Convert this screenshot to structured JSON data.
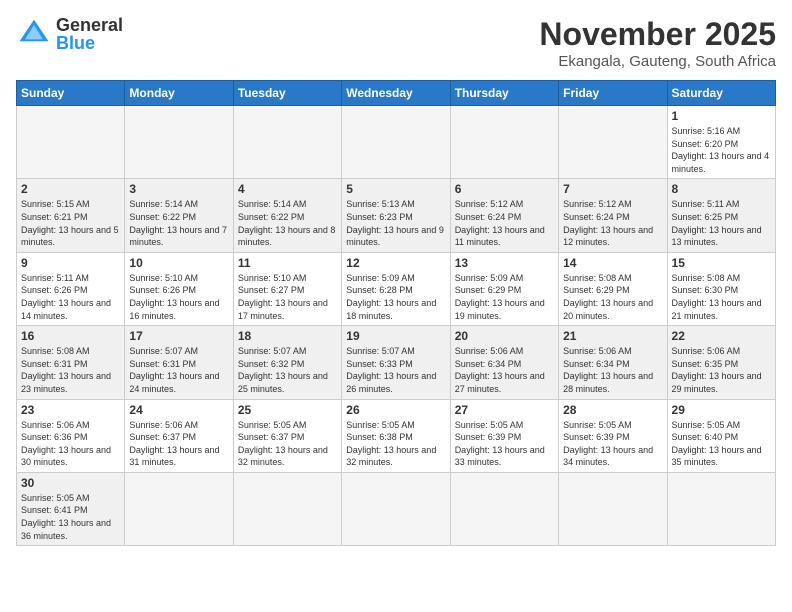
{
  "header": {
    "logo_general": "General",
    "logo_blue": "Blue",
    "month": "November 2025",
    "location": "Ekangala, Gauteng, South Africa"
  },
  "days_of_week": [
    "Sunday",
    "Monday",
    "Tuesday",
    "Wednesday",
    "Thursday",
    "Friday",
    "Saturday"
  ],
  "weeks": [
    [
      {
        "day": "",
        "info": ""
      },
      {
        "day": "",
        "info": ""
      },
      {
        "day": "",
        "info": ""
      },
      {
        "day": "",
        "info": ""
      },
      {
        "day": "",
        "info": ""
      },
      {
        "day": "",
        "info": ""
      },
      {
        "day": "1",
        "info": "Sunrise: 5:16 AM\nSunset: 6:20 PM\nDaylight: 13 hours and 4 minutes."
      }
    ],
    [
      {
        "day": "2",
        "info": "Sunrise: 5:15 AM\nSunset: 6:21 PM\nDaylight: 13 hours and 5 minutes."
      },
      {
        "day": "3",
        "info": "Sunrise: 5:14 AM\nSunset: 6:22 PM\nDaylight: 13 hours and 7 minutes."
      },
      {
        "day": "4",
        "info": "Sunrise: 5:14 AM\nSunset: 6:22 PM\nDaylight: 13 hours and 8 minutes."
      },
      {
        "day": "5",
        "info": "Sunrise: 5:13 AM\nSunset: 6:23 PM\nDaylight: 13 hours and 9 minutes."
      },
      {
        "day": "6",
        "info": "Sunrise: 5:12 AM\nSunset: 6:24 PM\nDaylight: 13 hours and 11 minutes."
      },
      {
        "day": "7",
        "info": "Sunrise: 5:12 AM\nSunset: 6:24 PM\nDaylight: 13 hours and 12 minutes."
      },
      {
        "day": "8",
        "info": "Sunrise: 5:11 AM\nSunset: 6:25 PM\nDaylight: 13 hours and 13 minutes."
      }
    ],
    [
      {
        "day": "9",
        "info": "Sunrise: 5:11 AM\nSunset: 6:26 PM\nDaylight: 13 hours and 14 minutes."
      },
      {
        "day": "10",
        "info": "Sunrise: 5:10 AM\nSunset: 6:26 PM\nDaylight: 13 hours and 16 minutes."
      },
      {
        "day": "11",
        "info": "Sunrise: 5:10 AM\nSunset: 6:27 PM\nDaylight: 13 hours and 17 minutes."
      },
      {
        "day": "12",
        "info": "Sunrise: 5:09 AM\nSunset: 6:28 PM\nDaylight: 13 hours and 18 minutes."
      },
      {
        "day": "13",
        "info": "Sunrise: 5:09 AM\nSunset: 6:29 PM\nDaylight: 13 hours and 19 minutes."
      },
      {
        "day": "14",
        "info": "Sunrise: 5:08 AM\nSunset: 6:29 PM\nDaylight: 13 hours and 20 minutes."
      },
      {
        "day": "15",
        "info": "Sunrise: 5:08 AM\nSunset: 6:30 PM\nDaylight: 13 hours and 21 minutes."
      }
    ],
    [
      {
        "day": "16",
        "info": "Sunrise: 5:08 AM\nSunset: 6:31 PM\nDaylight: 13 hours and 23 minutes."
      },
      {
        "day": "17",
        "info": "Sunrise: 5:07 AM\nSunset: 6:31 PM\nDaylight: 13 hours and 24 minutes."
      },
      {
        "day": "18",
        "info": "Sunrise: 5:07 AM\nSunset: 6:32 PM\nDaylight: 13 hours and 25 minutes."
      },
      {
        "day": "19",
        "info": "Sunrise: 5:07 AM\nSunset: 6:33 PM\nDaylight: 13 hours and 26 minutes."
      },
      {
        "day": "20",
        "info": "Sunrise: 5:06 AM\nSunset: 6:34 PM\nDaylight: 13 hours and 27 minutes."
      },
      {
        "day": "21",
        "info": "Sunrise: 5:06 AM\nSunset: 6:34 PM\nDaylight: 13 hours and 28 minutes."
      },
      {
        "day": "22",
        "info": "Sunrise: 5:06 AM\nSunset: 6:35 PM\nDaylight: 13 hours and 29 minutes."
      }
    ],
    [
      {
        "day": "23",
        "info": "Sunrise: 5:06 AM\nSunset: 6:36 PM\nDaylight: 13 hours and 30 minutes."
      },
      {
        "day": "24",
        "info": "Sunrise: 5:06 AM\nSunset: 6:37 PM\nDaylight: 13 hours and 31 minutes."
      },
      {
        "day": "25",
        "info": "Sunrise: 5:05 AM\nSunset: 6:37 PM\nDaylight: 13 hours and 32 minutes."
      },
      {
        "day": "26",
        "info": "Sunrise: 5:05 AM\nSunset: 6:38 PM\nDaylight: 13 hours and 32 minutes."
      },
      {
        "day": "27",
        "info": "Sunrise: 5:05 AM\nSunset: 6:39 PM\nDaylight: 13 hours and 33 minutes."
      },
      {
        "day": "28",
        "info": "Sunrise: 5:05 AM\nSunset: 6:39 PM\nDaylight: 13 hours and 34 minutes."
      },
      {
        "day": "29",
        "info": "Sunrise: 5:05 AM\nSunset: 6:40 PM\nDaylight: 13 hours and 35 minutes."
      }
    ],
    [
      {
        "day": "30",
        "info": "Sunrise: 5:05 AM\nSunset: 6:41 PM\nDaylight: 13 hours and 36 minutes."
      },
      {
        "day": "",
        "info": ""
      },
      {
        "day": "",
        "info": ""
      },
      {
        "day": "",
        "info": ""
      },
      {
        "day": "",
        "info": ""
      },
      {
        "day": "",
        "info": ""
      },
      {
        "day": "",
        "info": ""
      }
    ]
  ]
}
